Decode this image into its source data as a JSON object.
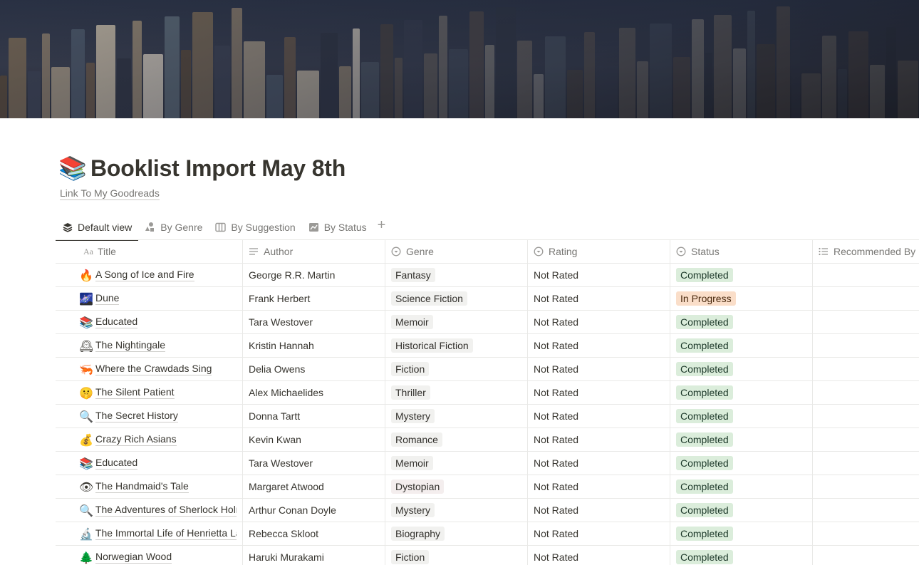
{
  "page": {
    "icon": "📚",
    "title": "Booklist Import May 8th",
    "link_text": "Link To My Goodreads"
  },
  "tabs": [
    {
      "label": "Default view",
      "icon": "layers-icon",
      "active": true
    },
    {
      "label": "By Genre",
      "icon": "shapes-icon",
      "active": false
    },
    {
      "label": "By Suggestion",
      "icon": "board-icon",
      "active": false
    },
    {
      "label": "By Status",
      "icon": "chart-icon",
      "active": false
    }
  ],
  "add_view_label": "+",
  "columns": {
    "title": "Title",
    "title_icon_text": "Aa",
    "author": "Author",
    "genre": "Genre",
    "rating": "Rating",
    "status": "Status",
    "recommended_by": "Recommended By"
  },
  "colors": {
    "completed_bg": "#dbeddb",
    "in_progress_bg": "#fadec9",
    "default_tag_bg": "#f1f1ef",
    "dystopian_tag_bg": "#f4eeee"
  },
  "rows": [
    {
      "emoji": "🔥",
      "title": "A Song of Ice and Fire",
      "author": "George R.R. Martin",
      "genre": "Fantasy",
      "genre_color": "gray",
      "rating": "Not Rated",
      "status": "Completed",
      "status_color": "green",
      "recommended_by": ""
    },
    {
      "emoji": "🌌",
      "title": "Dune",
      "author": "Frank Herbert",
      "genre": "Science Fiction",
      "genre_color": "gray",
      "rating": "Not Rated",
      "status": "In Progress",
      "status_color": "orange",
      "recommended_by": ""
    },
    {
      "emoji": "📚",
      "title": "Educated",
      "author": "Tara Westover",
      "genre": "Memoir",
      "genre_color": "gray",
      "rating": "Not Rated",
      "status": "Completed",
      "status_color": "green",
      "recommended_by": ""
    },
    {
      "emoji": "🕰",
      "title": "The Nightingale",
      "author": "Kristin Hannah",
      "genre": "Historical Fiction",
      "genre_color": "gray",
      "rating": "Not Rated",
      "status": "Completed",
      "status_color": "green",
      "recommended_by": ""
    },
    {
      "emoji": "🦐",
      "title": "Where the Crawdads Sing",
      "author": "Delia Owens",
      "genre": "Fiction",
      "genre_color": "gray",
      "rating": "Not Rated",
      "status": "Completed",
      "status_color": "green",
      "recommended_by": ""
    },
    {
      "emoji": "🤫",
      "title": "The Silent Patient",
      "author": "Alex Michaelides",
      "genre": "Thriller",
      "genre_color": "gray",
      "rating": "Not Rated",
      "status": "Completed",
      "status_color": "green",
      "recommended_by": ""
    },
    {
      "emoji": "🔍",
      "title": "The Secret History",
      "author": "Donna Tartt",
      "genre": "Mystery",
      "genre_color": "gray",
      "rating": "Not Rated",
      "status": "Completed",
      "status_color": "green",
      "recommended_by": ""
    },
    {
      "emoji": "💰",
      "title": "Crazy Rich Asians",
      "author": "Kevin Kwan",
      "genre": "Romance",
      "genre_color": "gray",
      "rating": "Not Rated",
      "status": "Completed",
      "status_color": "green",
      "recommended_by": ""
    },
    {
      "emoji": "📚",
      "title": "Educated",
      "author": "Tara Westover",
      "genre": "Memoir",
      "genre_color": "gray",
      "rating": "Not Rated",
      "status": "Completed",
      "status_color": "green",
      "recommended_by": ""
    },
    {
      "emoji": "👁",
      "title": "The Handmaid's Tale",
      "author": "Margaret Atwood",
      "genre": "Dystopian",
      "genre_color": "brown",
      "rating": "Not Rated",
      "status": "Completed",
      "status_color": "green",
      "recommended_by": ""
    },
    {
      "emoji": "🔍",
      "title": "The Adventures of Sherlock Holmes",
      "author": "Arthur Conan Doyle",
      "genre": "Mystery",
      "genre_color": "gray",
      "rating": "Not Rated",
      "status": "Completed",
      "status_color": "green",
      "recommended_by": ""
    },
    {
      "emoji": "🔬",
      "title": "The Immortal Life of Henrietta Lacks",
      "author": "Rebecca Skloot",
      "genre": "Biography",
      "genre_color": "gray",
      "rating": "Not Rated",
      "status": "Completed",
      "status_color": "green",
      "recommended_by": ""
    },
    {
      "emoji": "🌲",
      "title": "Norwegian Wood",
      "author": "Haruki Murakami",
      "genre": "Fiction",
      "genre_color": "gray",
      "rating": "Not Rated",
      "status": "Completed",
      "status_color": "green",
      "recommended_by": ""
    }
  ]
}
